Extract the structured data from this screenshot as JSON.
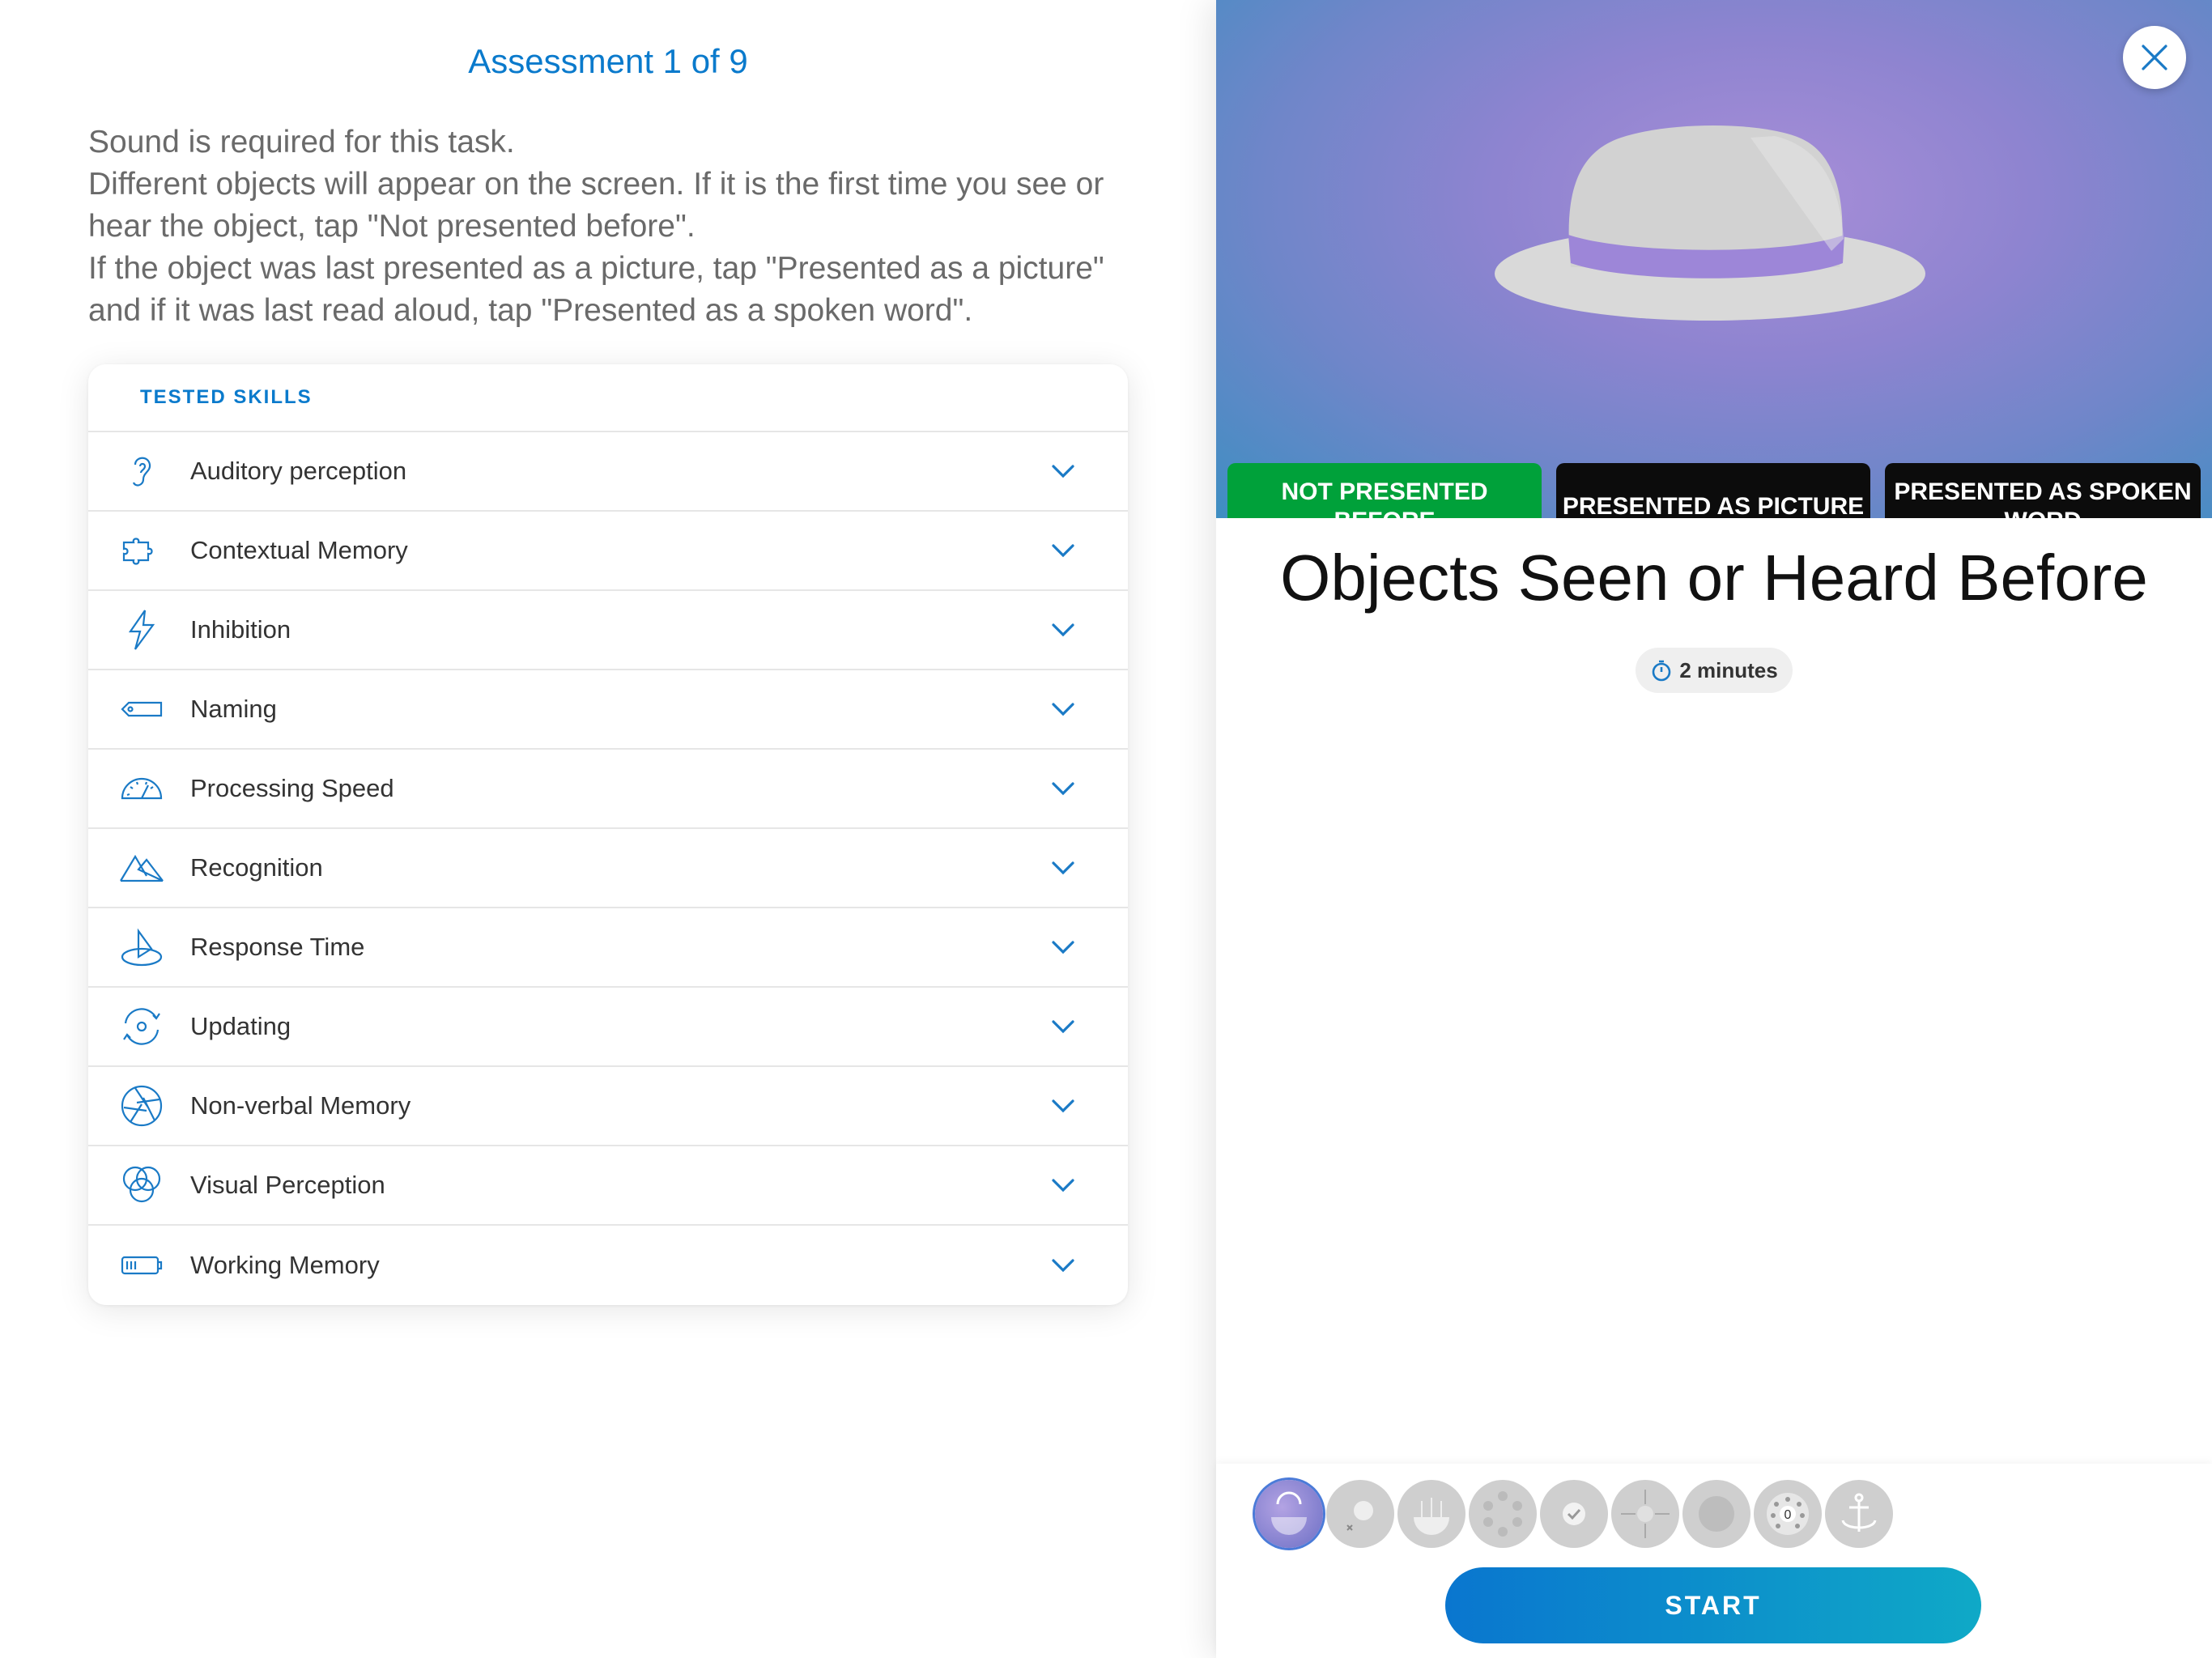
{
  "assessment": {
    "title": "Assessment 1 of 9"
  },
  "instructions": [
    "Sound is required for this task.",
    "Different objects will appear on the screen. If it is the first time you see or hear the object, tap \"Not presented before\".",
    "If the object was last presented as a picture, tap \"Presented as a picture\" and if it was last read aloud, tap \"Presented as a spoken word\"."
  ],
  "skills": {
    "header": "TESTED SKILLS",
    "items": [
      {
        "label": "Auditory perception",
        "icon": "ear-icon"
      },
      {
        "label": "Contextual Memory",
        "icon": "puzzle-icon"
      },
      {
        "label": "Inhibition",
        "icon": "lightning-icon"
      },
      {
        "label": "Naming",
        "icon": "tag-icon"
      },
      {
        "label": "Processing Speed",
        "icon": "speedometer-icon"
      },
      {
        "label": "Recognition",
        "icon": "mountains-icon"
      },
      {
        "label": "Response Time",
        "icon": "sundial-icon"
      },
      {
        "label": "Updating",
        "icon": "refresh-eye-icon"
      },
      {
        "label": "Non-verbal Memory",
        "icon": "aperture-icon"
      },
      {
        "label": "Visual Perception",
        "icon": "circles-icon"
      },
      {
        "label": "Working Memory",
        "icon": "battery-icon"
      }
    ]
  },
  "preview": {
    "buttons": [
      "NOT PRESENTED BEFORE",
      "PRESENTED AS PICTURE",
      "PRESENTED AS SPOKEN WORD"
    ],
    "image": "hat-icon"
  },
  "task": {
    "title": "Objects Seen or Heard Before",
    "duration": "2 minutes"
  },
  "footer": {
    "start_label": "START"
  },
  "colors": {
    "accent": "#0a7acc",
    "green": "#00a13a",
    "hero_purple": "#8e84d0"
  }
}
